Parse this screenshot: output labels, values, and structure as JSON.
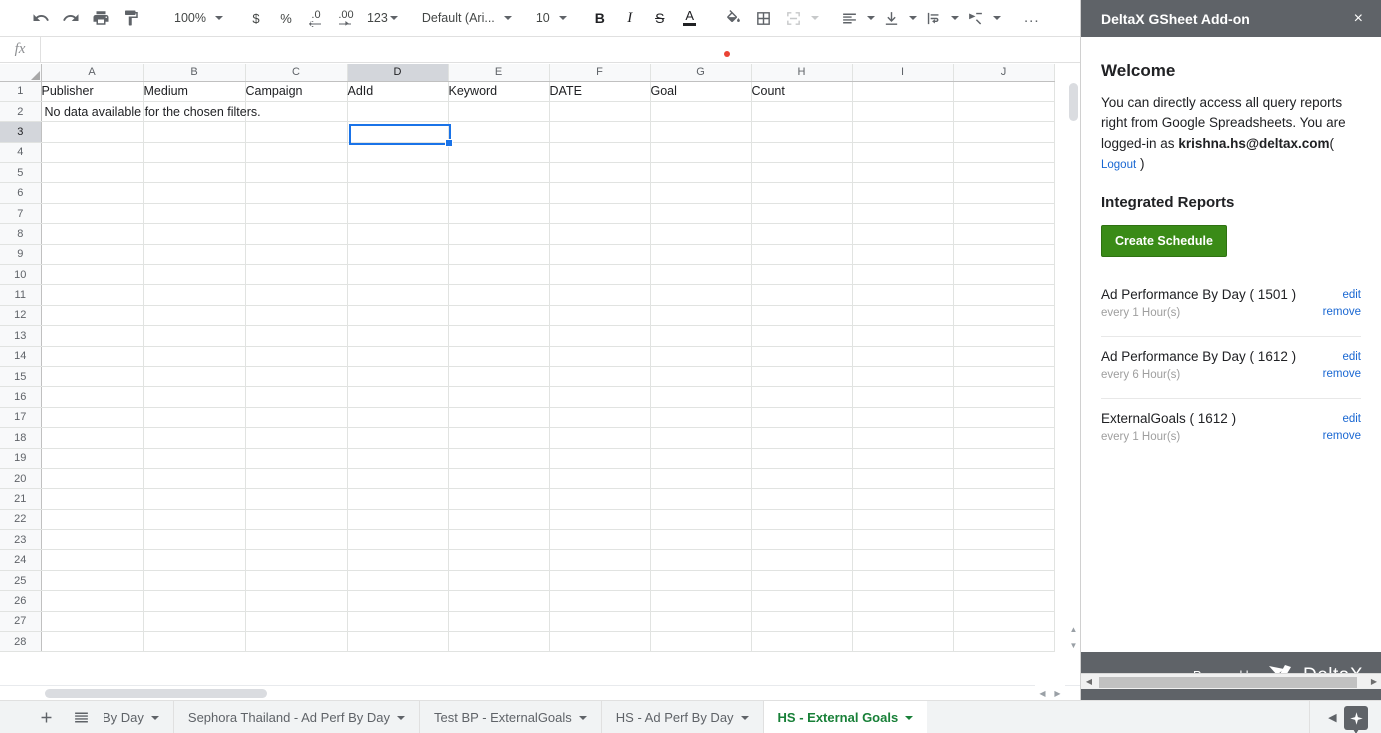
{
  "toolbar": {
    "undo": "undo-icon",
    "redo": "redo-icon",
    "print": "print-icon",
    "paint_format": "paint-format-icon",
    "zoom": "100%",
    "currency": "$",
    "percent": "%",
    "decrease_decimal": ".0",
    "increase_decimal": ".00",
    "number_format": "123",
    "font": "Default (Ari...",
    "font_size": "10",
    "bold": "B",
    "italic": "I",
    "strikethrough": "S",
    "text_color": "A",
    "more": "..."
  },
  "formula_bar": {
    "fx": "fx",
    "value": "",
    "placeholder": ""
  },
  "grid": {
    "columns": [
      "A",
      "B",
      "C",
      "D",
      "E",
      "F",
      "G",
      "H",
      "I",
      "J"
    ],
    "selected_column": "D",
    "selected_row": "3",
    "selected_cell": "D3",
    "rows": [
      "1",
      "2",
      "3",
      "4",
      "5",
      "6",
      "7",
      "8",
      "9",
      "10",
      "11",
      "12",
      "13",
      "14",
      "15",
      "16",
      "17",
      "18",
      "19",
      "20",
      "21",
      "22",
      "23",
      "24",
      "25",
      "26",
      "27",
      "28"
    ],
    "header_row": [
      "Publisher",
      "Medium",
      "Campaign",
      "AdId",
      "Keyword",
      "DATE",
      "Goal",
      "Count",
      "",
      ""
    ],
    "message_row": "No data available for the chosen filters."
  },
  "tabs": {
    "add_label": "add-sheet-icon",
    "all_sheets_label": "all-sheets-icon",
    "items": [
      {
        "label": "By Day",
        "active": false
      },
      {
        "label": "Sephora Thailand - Ad Perf By Day",
        "active": false
      },
      {
        "label": "Test BP - ExternalGoals",
        "active": false
      },
      {
        "label": "HS - Ad Perf By Day",
        "active": false
      },
      {
        "label": "HS - External Goals",
        "active": true
      }
    ],
    "prev": "prev-sheet-icon",
    "next": "next-sheet-icon",
    "explore": "explore-icon"
  },
  "addon": {
    "title": "DeltaX GSheet Add-on",
    "close": "×",
    "welcome_heading": "Welcome",
    "welcome_text_1": "You can directly access all query reports right from Google Spreadsheets. You are logged-in as ",
    "user_email": "krishna.hs@deltax.com",
    "paren_open": "( ",
    "logout": "Logout",
    "paren_close": " )",
    "section_title": "Integrated Reports",
    "create_schedule": "Create Schedule",
    "reports": [
      {
        "name": "Ad Performance By Day ( 1501 )",
        "frequency": "every 1 Hour(s)",
        "edit": "edit",
        "remove": "remove"
      },
      {
        "name": "Ad Performance By Day ( 1612 )",
        "frequency": "every 6 Hour(s)",
        "edit": "edit",
        "remove": "remove"
      },
      {
        "name": "ExternalGoals ( 1612 )",
        "frequency": "every 1 Hour(s)",
        "edit": "edit",
        "remove": "remove"
      }
    ],
    "footer_powered": "Powered by",
    "footer_brand": "DeltaX"
  },
  "colors": {
    "accent_blue": "#1a73e8",
    "green_button": "#3a8b17",
    "active_tab_green": "#188038",
    "header_gray": "#5f6368",
    "link_blue": "#1967d2",
    "red_dot": "#ea4335"
  }
}
